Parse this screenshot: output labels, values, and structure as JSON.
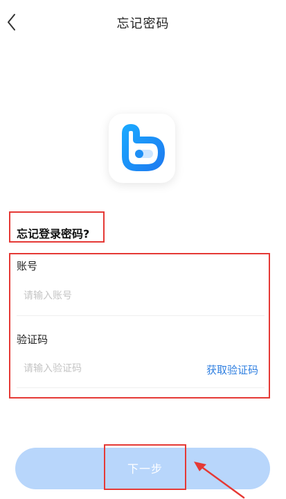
{
  "navbar": {
    "title": "忘记密码",
    "back_icon": "chevron-left-icon"
  },
  "logo": {
    "icon": "app-logo",
    "color": "#1e8ff5"
  },
  "form": {
    "heading": "忘记登录密码?",
    "account": {
      "label": "账号",
      "placeholder": "请输入账号",
      "value": ""
    },
    "code": {
      "label": "验证码",
      "placeholder": "请输入验证码",
      "value": "",
      "get_code_label": "获取验证码"
    }
  },
  "actions": {
    "next_label": "下一步",
    "button_color": "#b8d6fb"
  },
  "colors": {
    "accent": "#2f7fe0",
    "highlight_border": "#e53935"
  }
}
